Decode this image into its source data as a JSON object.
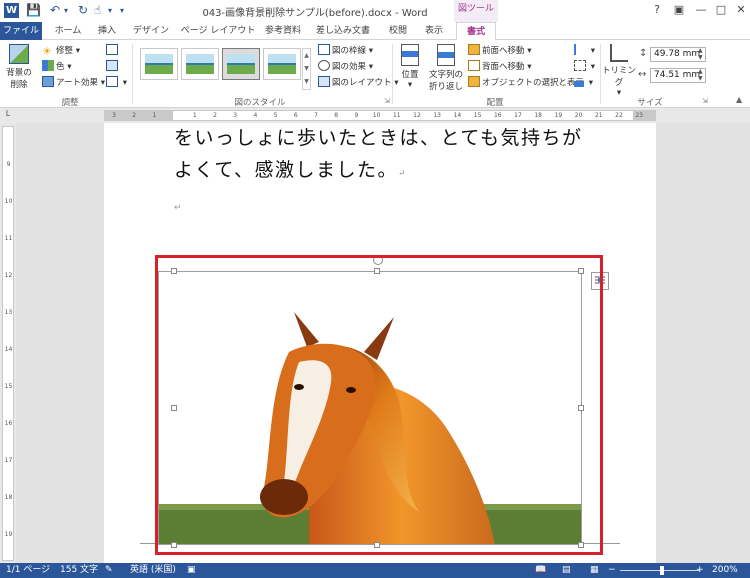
{
  "window": {
    "title": "043-画像背景削除サンプル(before).docx - Word",
    "context_tab_title": "図ツール",
    "app_icon": "W"
  },
  "tabs": [
    {
      "label": "ファイル"
    },
    {
      "label": "ホーム"
    },
    {
      "label": "挿入"
    },
    {
      "label": "デザイン"
    },
    {
      "label": "ページ レイアウト"
    },
    {
      "label": "参考資料"
    },
    {
      "label": "差し込み文書"
    },
    {
      "label": "校閲"
    },
    {
      "label": "表示"
    },
    {
      "label": "書式"
    }
  ],
  "ribbon": {
    "adjust": {
      "remove_bg_line1": "背景の",
      "remove_bg_line2": "削除",
      "corrections": "修整",
      "color": "色",
      "artistic": "アート効果",
      "label": "調整"
    },
    "styles": {
      "border": "図の枠線",
      "effects": "図の効果",
      "layout": "図のレイアウト",
      "label": "図のスタイル"
    },
    "arrange": {
      "position": "位置",
      "wrap_line1": "文字列の",
      "wrap_line2": "折り返し",
      "bring_forward": "前面へ移動",
      "send_backward": "背面へ移動",
      "selection_pane": "オブジェクトの選択と表示",
      "label": "配置"
    },
    "size": {
      "crop": "トリミング",
      "height": "49.78 mm",
      "width": "74.51 mm",
      "label": "サイズ"
    }
  },
  "ruler": {
    "h_ticks": [
      "3",
      "2",
      "1",
      "",
      "1",
      "2",
      "3",
      "4",
      "5",
      "6",
      "7",
      "8",
      "9",
      "10",
      "11",
      "12",
      "13",
      "14",
      "15",
      "16",
      "17",
      "18",
      "19",
      "20",
      "21",
      "22",
      "23"
    ],
    "v_ticks": [
      "9",
      "10",
      "11",
      "12",
      "13",
      "14",
      "15",
      "16",
      "17",
      "18",
      "19"
    ]
  },
  "document": {
    "line1": "をいっしょに歩いたときは、とても気持ちが",
    "line2": "よくて、感激しました。"
  },
  "status": {
    "page": "1/1 ページ",
    "words": "155 文字",
    "language": "英語 (米国)",
    "zoom": "200%"
  },
  "colors": {
    "word_blue": "#2b579a",
    "context_accent": "#a4378f",
    "highlight_red": "#d6202a"
  }
}
